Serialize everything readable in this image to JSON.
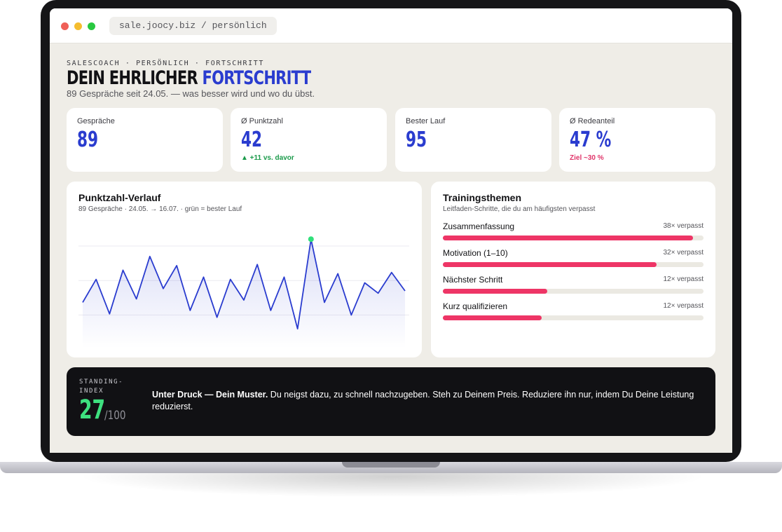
{
  "browser": {
    "url": "sale.joocy.biz / persönlich"
  },
  "header": {
    "eyebrow": "SALESCOACH · PERSÖNLICH · FORTSCHRITT",
    "title_main": "DEIN EHRLICHER ",
    "title_accent": "FORTSCHRITT",
    "subtitle": "89 Gespräche seit 24.05. — was besser wird und wo du übst."
  },
  "kpis": [
    {
      "label": "Gespräche",
      "value": "89",
      "delta": ""
    },
    {
      "label": "Ø Punktzahl",
      "value": "42",
      "delta": "▲ +11 vs. davor"
    },
    {
      "label": "Bester Lauf",
      "value": "95",
      "delta": ""
    },
    {
      "label": "Ø Redeanteil",
      "value": "47 %",
      "delta": "Ziel ~30 %"
    }
  ],
  "score_chart": {
    "title": "Punktzahl-Verlauf",
    "subtitle": "89 Gespräche · 24.05. → 16.07. · grün = bester Lauf"
  },
  "chart_data": {
    "type": "area",
    "title": "Punktzahl-Verlauf",
    "xlabel": "",
    "ylabel": "",
    "ylim": [
      0,
      100
    ],
    "grid": true,
    "highlight_color": "#2fe07a",
    "line_color": "#2a3ccf",
    "series": [
      {
        "values": [
          40,
          60,
          30,
          68,
          43,
          80,
          52,
          72,
          33,
          62,
          27,
          60,
          42,
          73,
          33,
          62,
          17,
          95,
          40,
          65,
          29,
          57,
          48,
          66,
          50
        ]
      }
    ]
  },
  "topics": {
    "title": "Trainingsthemen",
    "subtitle": "Leitfaden-Schritte, die du am häufigsten verpasst",
    "items": [
      {
        "name": "Zusammenfassung",
        "count": "38× verpasst",
        "fraction": 0.96
      },
      {
        "name": "Motivation (1–10)",
        "count": "32× verpasst",
        "fraction": 0.82
      },
      {
        "name": "Nächster Schritt",
        "count": "12× verpasst",
        "fraction": 0.4
      },
      {
        "name": "Kurz qualifizieren",
        "count": "12× verpasst",
        "fraction": 0.38
      }
    ]
  },
  "standing": {
    "label": "STANDING-INDEX",
    "value": "27",
    "max": "/100",
    "headline": "Unter Druck — Dein Muster.",
    "text": " Du neigst dazu, zu schnell nachzugeben. Steh zu Deinem Preis. Reduziere ihn nur, indem Du Deine Leistung reduzierst."
  },
  "colors": {
    "accent": "#2a3ccf",
    "miss_bar": "#ee3566",
    "positive": "#1a9a4a",
    "warning": "#e0356a",
    "standing": "#3ee07f"
  }
}
